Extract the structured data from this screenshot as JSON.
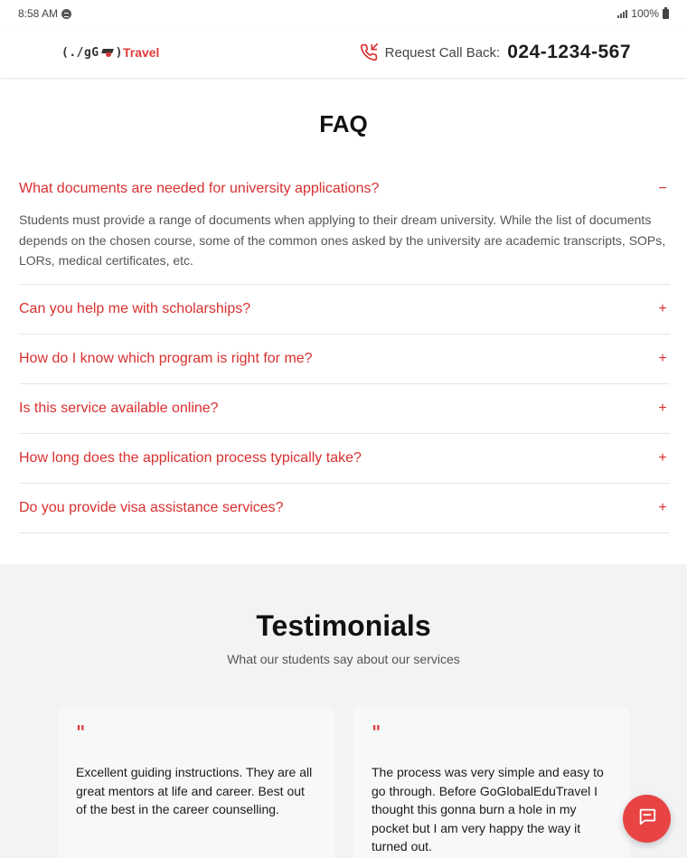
{
  "status": {
    "time": "8:58 AM",
    "battery": "100%"
  },
  "header": {
    "logo_prefix": "(./gG",
    "logo_suffix": ")",
    "logo_brand": "Travel",
    "callback_label": "Request Call Back:",
    "callback_number": "024-1234-567"
  },
  "faq": {
    "title": "FAQ",
    "items": [
      {
        "question": "What documents are needed for university applications?",
        "answer": "Students must provide a range of documents when applying to their dream university. While the list of documents depends on the chosen course, some of the common ones asked by the university are academic transcripts, SOPs, LORs, medical certificates, etc.",
        "toggle": "−"
      },
      {
        "question": "Can you help me with scholarships?",
        "toggle": "+"
      },
      {
        "question": "How do I know which program is right for me?",
        "toggle": "+"
      },
      {
        "question": "Is this service available online?",
        "toggle": "+"
      },
      {
        "question": "How long does the application process typically take?",
        "toggle": "+"
      },
      {
        "question": "Do you provide visa assistance services?",
        "toggle": "+"
      }
    ]
  },
  "testimonials": {
    "title": "Testimonials",
    "subtitle": "What our students say about our services",
    "quote_mark": "\"",
    "cards": [
      {
        "text": "Excellent guiding instructions. They are all great mentors at life and career. Best out of the best in the career counselling."
      },
      {
        "text": "The process was very simple and easy to go through. Before GoGlobalEduTravel I thought this gonna burn a hole in my pocket but I am very happy the way it turned out."
      }
    ]
  },
  "icons": {
    "status_app": "message-icon",
    "signal": "signal-icon",
    "battery": "battery-icon",
    "phone": "phone-callback-icon",
    "chat": "chat-icon"
  },
  "colors": {
    "accent": "#d93030",
    "fab": "#e84444",
    "testimonial_bg": "#f2f3f5"
  }
}
